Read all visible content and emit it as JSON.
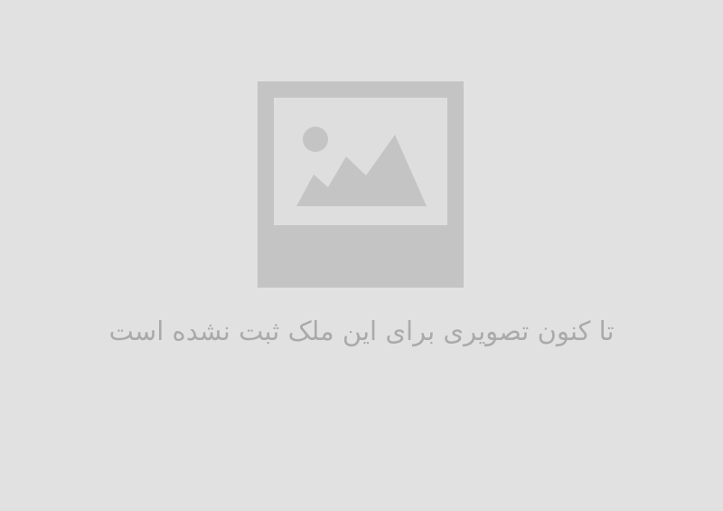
{
  "placeholder": {
    "icon": "image-placeholder-icon",
    "message": "تا کنون تصویری برای این ملک ثبت نشده است",
    "colors": {
      "background": "#e1e1e1",
      "icon": "#c4c4c4",
      "icon_inner": "#dedede",
      "text": "#aaaaaa"
    }
  }
}
